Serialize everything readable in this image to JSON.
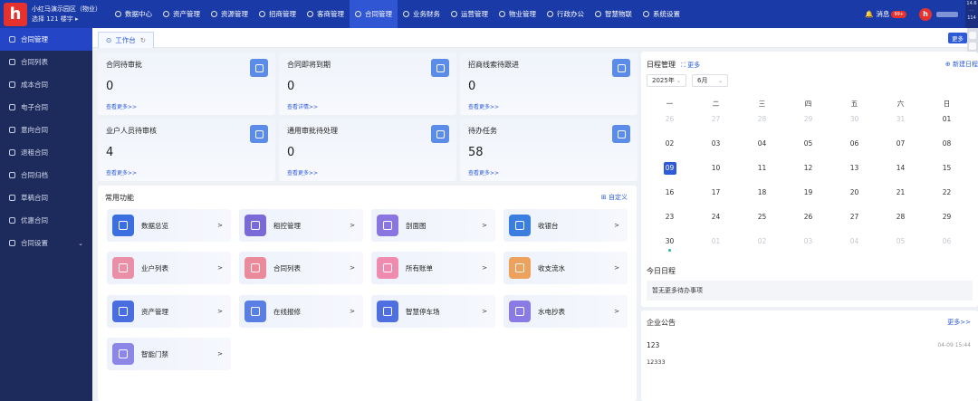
{
  "colors": {
    "primary": "#2d5bd7",
    "topbar": "#1a3aa8",
    "sidebar": "#1c2a5c",
    "accent_red": "#e6322e"
  },
  "header": {
    "logo_text": "h",
    "park_name": "小红马演示园区（物业）",
    "park_sub": "选择 121 楼宇 ▸",
    "nav": [
      {
        "label": "数据中心",
        "icon": "chart-icon"
      },
      {
        "label": "资产管理",
        "icon": "asset-icon"
      },
      {
        "label": "资源管理",
        "icon": "resource-icon"
      },
      {
        "label": "招商管理",
        "icon": "invest-icon"
      },
      {
        "label": "客商管理",
        "icon": "client-icon"
      },
      {
        "label": "合同管理",
        "icon": "contract-icon",
        "active": true
      },
      {
        "label": "业务财务",
        "icon": "finance-icon"
      },
      {
        "label": "运营管理",
        "icon": "operation-icon"
      },
      {
        "label": "物业管理",
        "icon": "property-icon"
      },
      {
        "label": "行政办公",
        "icon": "office-icon"
      },
      {
        "label": "智慧物联",
        "icon": "iot-icon"
      },
      {
        "label": "系统设置",
        "icon": "gear-icon"
      }
    ],
    "messages_label": "消息",
    "messages_badge": "99+",
    "edge_top": "14.6",
    "edge_mid": "114"
  },
  "sidebar": {
    "items": [
      {
        "label": "合同管理",
        "active": true
      },
      {
        "label": "合同列表"
      },
      {
        "label": "成本合同"
      },
      {
        "label": "电子合同"
      },
      {
        "label": "意向合同"
      },
      {
        "label": "退租合同"
      },
      {
        "label": "合同归档"
      },
      {
        "label": "草稿合同"
      },
      {
        "label": "优惠合同"
      },
      {
        "label": "合同设置",
        "expandable": true
      }
    ]
  },
  "tabs": {
    "workbench": "工作台",
    "more": "更多"
  },
  "stats": [
    {
      "title": "合同待审批",
      "value": "0",
      "link": "查看更多>>"
    },
    {
      "title": "合同即将到期",
      "value": "0",
      "link": "查看详情>>"
    },
    {
      "title": "招商线索待跟进",
      "value": "0",
      "link": "查看更多>>"
    },
    {
      "title": "业户人员待审核",
      "value": "4",
      "link": "查看更多>>"
    },
    {
      "title": "通用审批待处理",
      "value": "0",
      "link": "查看更多>>"
    },
    {
      "title": "待办任务",
      "value": "58",
      "link": "查看更多>>"
    }
  ],
  "common": {
    "title": "常用功能",
    "customize": "自定义",
    "items": [
      {
        "label": "数据总览",
        "color": "#3b6fe0"
      },
      {
        "label": "租控管理",
        "color": "#7a6ad8"
      },
      {
        "label": "剖面图",
        "color": "#8a76e0"
      },
      {
        "label": "收银台",
        "color": "#3a7fe0"
      },
      {
        "label": "业户列表",
        "color": "#e98fa8"
      },
      {
        "label": "合同列表",
        "color": "#ea8a9a"
      },
      {
        "label": "所有账单",
        "color": "#f08bb0"
      },
      {
        "label": "收支流水",
        "color": "#eca15d"
      },
      {
        "label": "资产管理",
        "color": "#4a6ee0"
      },
      {
        "label": "在线报修",
        "color": "#5a7fe4"
      },
      {
        "label": "智慧停车场",
        "color": "#4f6fe0"
      },
      {
        "label": "水电抄表",
        "color": "#8a7ae4"
      },
      {
        "label": "智能门禁",
        "color": "#8c86e6"
      }
    ]
  },
  "calendar": {
    "title": "日程管理",
    "more": "更多",
    "new_schedule": "新建日程",
    "year": "2025年",
    "month": "6月",
    "weekdays": [
      "一",
      "二",
      "三",
      "四",
      "五",
      "六",
      "日"
    ],
    "weeks": [
      [
        "26",
        "27",
        "28",
        "29",
        "30",
        "31",
        "01"
      ],
      [
        "02",
        "03",
        "04",
        "05",
        "06",
        "07",
        "08"
      ],
      [
        "09",
        "10",
        "11",
        "12",
        "13",
        "14",
        "15"
      ],
      [
        "16",
        "17",
        "18",
        "19",
        "20",
        "21",
        "22"
      ],
      [
        "23",
        "24",
        "25",
        "26",
        "27",
        "28",
        "29"
      ],
      [
        "30",
        "01",
        "02",
        "03",
        "04",
        "05",
        "06"
      ]
    ],
    "today_title": "今日日程",
    "today_empty": "暂无更多待办事项"
  },
  "notice": {
    "title": "企业公告",
    "more": "更多>>",
    "item_title": "123",
    "item_date": "04-09 15:44",
    "item_content": "12333"
  }
}
